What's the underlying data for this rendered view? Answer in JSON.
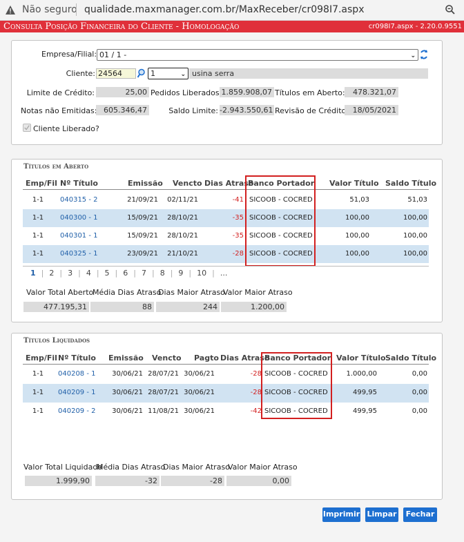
{
  "browser": {
    "not_secure": "Não seguro",
    "url": "qualidade.maxmanager.com.br/MaxReceber/cr098I7.aspx"
  },
  "titlebar": {
    "title": "Consulta Posição Financeira do Cliente  - Homologação",
    "version": "cr098I7.aspx - 2.20.0.9551"
  },
  "form": {
    "empresa_label": "Empresa/Filial:",
    "empresa_value": "01 / 1 -",
    "cliente_label": "Cliente:",
    "cliente_code": "24564",
    "cliente_seq": "1",
    "cliente_name": "usina serra",
    "limite_label": "Limite de Crédito:",
    "limite_value": "25,00",
    "pedidos_label": "Pedidos Liberados:",
    "pedidos_value": "1.859.908,07",
    "titulos_label": "Títulos em Aberto:",
    "titulos_value": "478.321,07",
    "notas_label": "Notas não Emitidas:",
    "notas_value": "605.346,47",
    "saldo_label": "Saldo Limite:",
    "saldo_value": "-2.943.550,61",
    "revisao_label": "Revisão de Crédito:",
    "revisao_value": "18/05/2021",
    "liberado_label": "Cliente Liberado?"
  },
  "open": {
    "legend": "Títulos em Aberto",
    "headers": [
      "Emp/Fil",
      "Nº Título",
      "Emissão",
      "Vencto",
      "Dias Atraso",
      "Banco Portador",
      "Valor Título",
      "Saldo Título"
    ],
    "rows": [
      [
        "1-1",
        "040315 - 2",
        "21/09/21",
        "02/11/21",
        "-41",
        "SICOOB - COCRED",
        "51,03",
        "51,03"
      ],
      [
        "1-1",
        "040300 - 1",
        "15/09/21",
        "28/10/21",
        "-35",
        "SICOOB - COCRED",
        "100,00",
        "100,00"
      ],
      [
        "1-1",
        "040301 - 1",
        "15/09/21",
        "28/10/21",
        "-35",
        "SICOOB - COCRED",
        "100,00",
        "100,00"
      ],
      [
        "1-1",
        "040325 - 1",
        "23/09/21",
        "21/10/21",
        "-28",
        "SICOOB - COCRED",
        "100,00",
        "100,00"
      ]
    ],
    "pages": [
      "1",
      "2",
      "3",
      "4",
      "5",
      "6",
      "7",
      "8",
      "9",
      "10",
      "..."
    ],
    "totals_labels": [
      "Valor Total Aberto",
      "Média Dias Atraso",
      "Dias Maior Atraso",
      "Valor Maior Atraso"
    ],
    "totals_values": [
      "477.195,31",
      "88",
      "244",
      "1.200,00"
    ]
  },
  "paid": {
    "legend": "Títulos Liquidados",
    "headers": [
      "Emp/Fil",
      "Nº Título",
      "Emissão",
      "Vencto",
      "Pagto",
      "Dias Atraso",
      "Banco Portador",
      "Valor Título",
      "Saldo Título"
    ],
    "rows": [
      [
        "1-1",
        "040208 - 1",
        "30/06/21",
        "28/07/21",
        "30/06/21",
        "-28",
        "SICOOB - COCRED",
        "1.000,00",
        "0,00"
      ],
      [
        "1-1",
        "040209 - 1",
        "30/06/21",
        "28/07/21",
        "30/06/21",
        "-28",
        "SICOOB - COCRED",
        "499,95",
        "0,00"
      ],
      [
        "1-1",
        "040209 - 2",
        "30/06/21",
        "11/08/21",
        "30/06/21",
        "-42",
        "SICOOB - COCRED",
        "499,95",
        "0,00"
      ]
    ],
    "totals_labels": [
      "Valor Total Liquidado",
      "Média Dias Atraso",
      "Dias Maior Atraso",
      "Valor Maior Atraso"
    ],
    "totals_values": [
      "1.999,90",
      "-32",
      "-28",
      "0,00"
    ]
  },
  "buttons": {
    "print": "Imprimir",
    "clear": "Limpar",
    "close": "Fechar"
  },
  "colors": {
    "title_bg": "#e0303a",
    "row_alt": "#d1e3f2",
    "button": "#1d6fd0",
    "highlight": "#d21f1f"
  }
}
